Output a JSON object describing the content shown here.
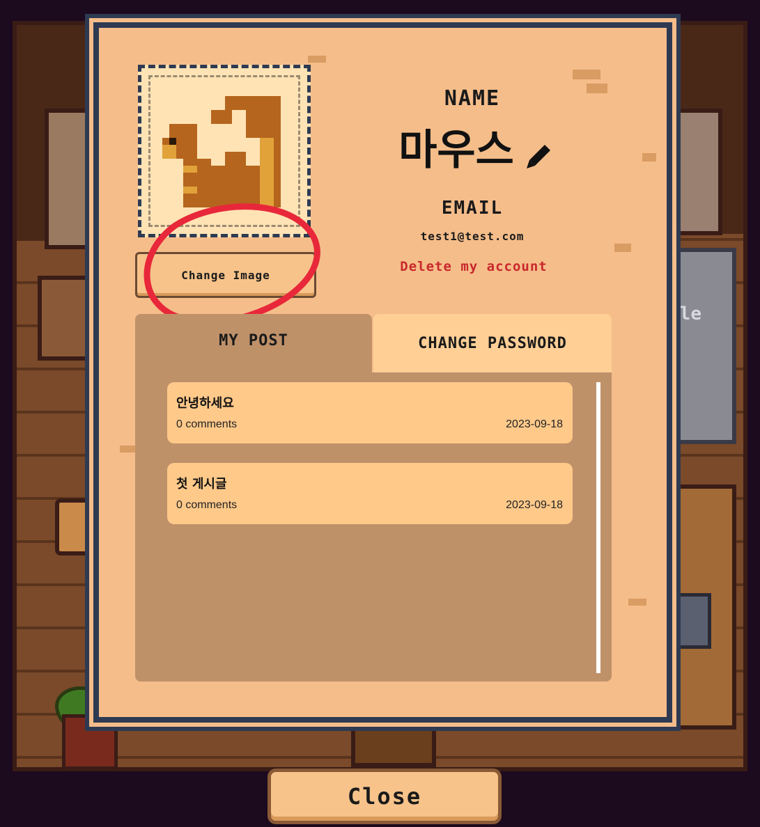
{
  "profile": {
    "name_label": "NAME",
    "name_value": "마우스",
    "email_label": "EMAIL",
    "email_value": "test1@test.com",
    "delete_label": "Delete my account",
    "change_image_label": "Change Image",
    "avatar_icon": "squirrel-pixel-icon",
    "edit_icon": "pencil-icon"
  },
  "background": {
    "partial_sign_text": "ofile"
  },
  "tabs": [
    {
      "label": "MY POST",
      "active": true
    },
    {
      "label": "CHANGE PASSWORD",
      "active": false
    }
  ],
  "posts": [
    {
      "title": "안녕하세요",
      "comments": "0 comments",
      "date": "2023-09-18"
    },
    {
      "title": "첫 게시글",
      "comments": "0 comments",
      "date": "2023-09-18"
    }
  ],
  "close_label": "Close",
  "colors": {
    "parchment": "#f5bd8a",
    "frame_border": "#2e3a52",
    "active_tab": "#bf9169",
    "inactive_tab": "#ffcf96",
    "post_card": "#ffc98a",
    "danger": "#c8282c",
    "annotation": "#e8283a"
  }
}
